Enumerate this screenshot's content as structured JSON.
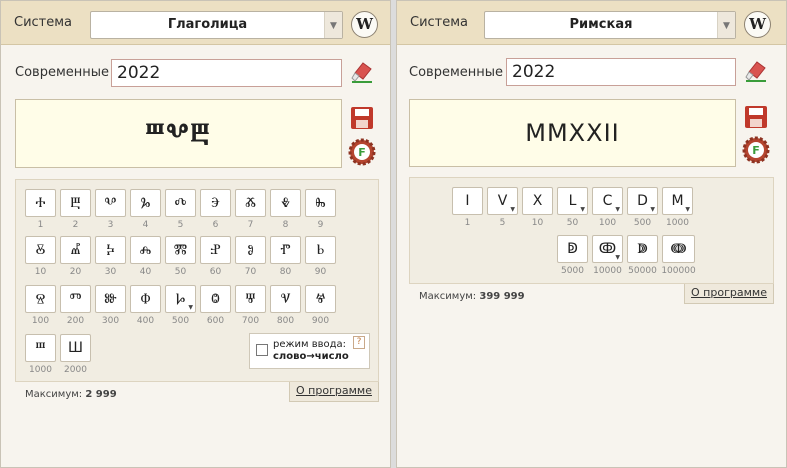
{
  "left": {
    "system_label": "Система",
    "system_value": "Глаголица",
    "modern_label": "Современные",
    "input_value": "2022",
    "output": "ⰞⰂⰁ",
    "keys_row1": [
      {
        "glyph": "Ⰰ",
        "num": "1"
      },
      {
        "glyph": "Ⰱ",
        "num": "2"
      },
      {
        "glyph": "Ⰲ",
        "num": "3"
      },
      {
        "glyph": "Ⰳ",
        "num": "4"
      },
      {
        "glyph": "Ⰴ",
        "num": "5"
      },
      {
        "glyph": "Ⰵ",
        "num": "6"
      },
      {
        "glyph": "Ⰶ",
        "num": "7"
      },
      {
        "glyph": "Ⰷ",
        "num": "8"
      },
      {
        "glyph": "Ⰸ",
        "num": "9"
      }
    ],
    "keys_row2": [
      {
        "glyph": "Ⰻ",
        "num": "10"
      },
      {
        "glyph": "Ⰼ",
        "num": "20"
      },
      {
        "glyph": "Ⰽ",
        "num": "30"
      },
      {
        "glyph": "Ⰾ",
        "num": "40"
      },
      {
        "glyph": "Ⰿ",
        "num": "50"
      },
      {
        "glyph": "Ⱀ",
        "num": "60"
      },
      {
        "glyph": "Ⱁ",
        "num": "70"
      },
      {
        "glyph": "Ⱂ",
        "num": "80"
      },
      {
        "glyph": "Ⱃ",
        "num": "90"
      }
    ],
    "keys_row3": [
      {
        "glyph": "Ⱄ",
        "num": "100"
      },
      {
        "glyph": "Ⱅ",
        "num": "200"
      },
      {
        "glyph": "Ⱆ",
        "num": "300"
      },
      {
        "glyph": "Ⱇ",
        "num": "400"
      },
      {
        "glyph": "Ⱈ",
        "num": "500"
      },
      {
        "glyph": "Ⱉ",
        "num": "600"
      },
      {
        "glyph": "Ⱋ",
        "num": "700"
      },
      {
        "glyph": "Ⱌ",
        "num": "800"
      },
      {
        "glyph": "Ⱍ",
        "num": "900"
      }
    ],
    "keys_row4": [
      {
        "glyph": "Ⱎ",
        "num": "1000"
      },
      {
        "glyph": "Ш",
        "num": "2000"
      }
    ],
    "mode_line1": "режим ввода:",
    "mode_line2": "слово→число",
    "help": "?",
    "max_label": "Максимум:",
    "max_value": "2 999",
    "about": "О программе"
  },
  "right": {
    "system_label": "Система",
    "system_value": "Римская",
    "modern_label": "Современные",
    "input_value": "2022",
    "output": "MMXXII",
    "keys_row1": [
      {
        "glyph": "I",
        "num": "1"
      },
      {
        "glyph": "V",
        "num": "5"
      },
      {
        "glyph": "X",
        "num": "10"
      },
      {
        "glyph": "L",
        "num": "50"
      },
      {
        "glyph": "C",
        "num": "100"
      },
      {
        "glyph": "D",
        "num": "500"
      },
      {
        "glyph": "M",
        "num": "1000"
      }
    ],
    "keys_row2": [
      {
        "glyph": "ↁ",
        "num": "5000"
      },
      {
        "glyph": "ↂ",
        "num": "10000"
      },
      {
        "glyph": "ↇ",
        "num": "50000"
      },
      {
        "glyph": "ↈ",
        "num": "100000"
      }
    ],
    "max_label": "Максимум:",
    "max_value": "399 999",
    "about": "О программе"
  },
  "icons": {
    "wiki": "W",
    "eraser": "eraser-icon",
    "save": "floppy-icon",
    "font": "F"
  },
  "colors": {
    "topbar": "#ece0c3",
    "output_bg": "#fffde8",
    "save_red": "#c0392b",
    "gear": "#b5452f",
    "green": "#3a9c3a"
  }
}
